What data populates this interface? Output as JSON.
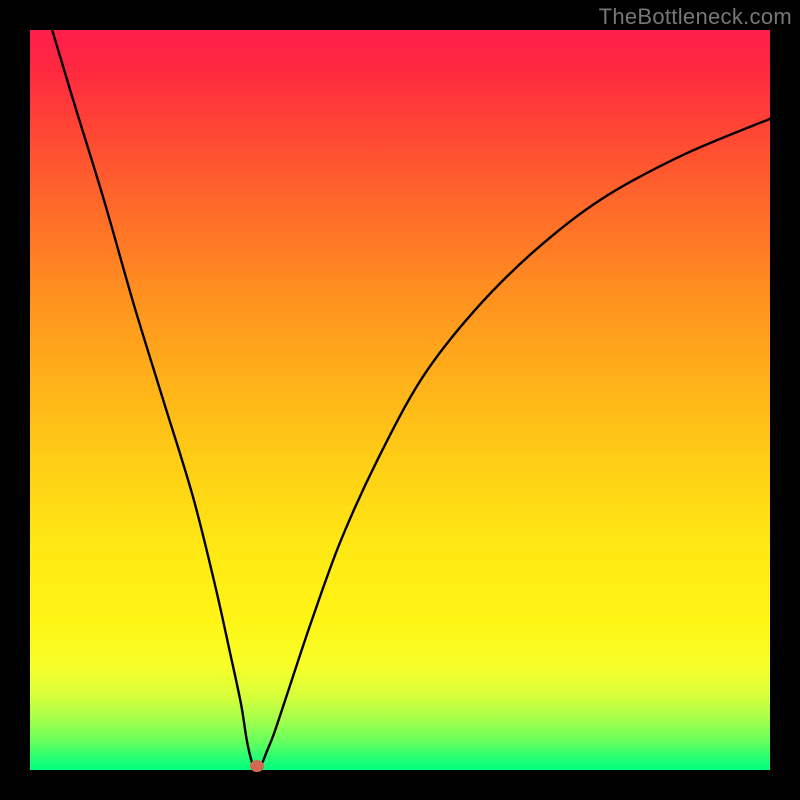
{
  "watermark": "TheBottleneck.com",
  "chart_data": {
    "type": "line",
    "title": "",
    "xlabel": "",
    "ylabel": "",
    "xlim": [
      0,
      100
    ],
    "ylim": [
      0,
      100
    ],
    "grid": false,
    "legend": false,
    "series": [
      {
        "name": "bottleneck-curve",
        "x": [
          3,
          6,
          10,
          14,
          18,
          22,
          25,
          27,
          28.5,
          29.3,
          30,
          30.5,
          31,
          31.4,
          32,
          33,
          35,
          38,
          42,
          47,
          53,
          60,
          68,
          77,
          88,
          100
        ],
        "y": [
          100,
          90,
          77,
          63,
          50,
          37,
          25,
          16,
          9,
          4,
          1,
          0,
          0.5,
          1,
          2.5,
          5,
          11,
          20,
          31,
          42,
          53,
          62,
          70,
          77,
          83,
          88
        ]
      }
    ],
    "marker": {
      "x": 30.7,
      "y": 0.6
    },
    "background_gradient": {
      "top_color": "#ff1d4a",
      "bottom_color": "#00ff7e"
    }
  }
}
